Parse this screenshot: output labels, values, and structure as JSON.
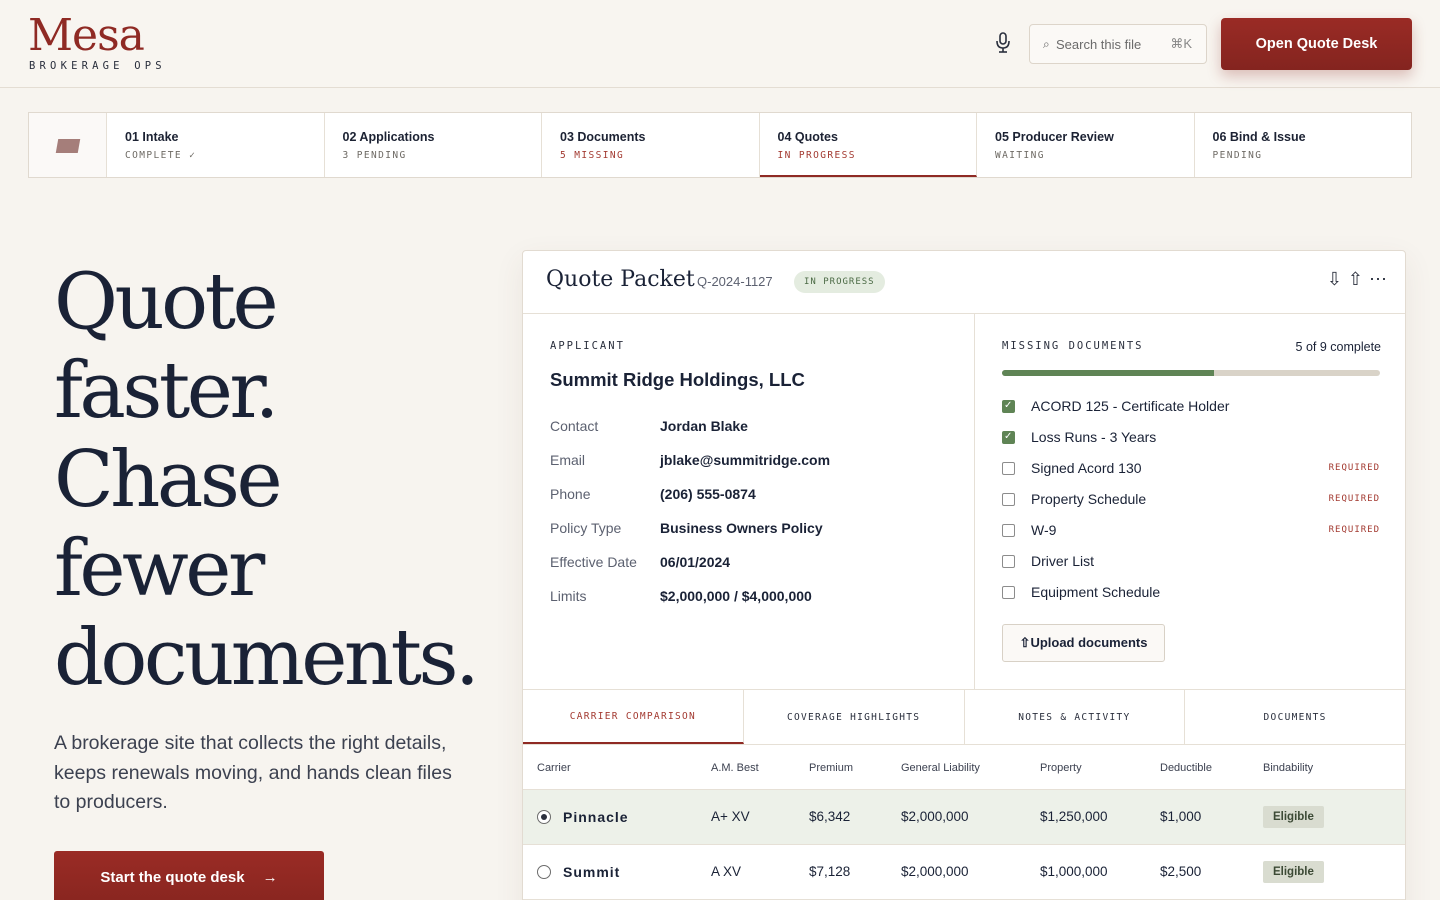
{
  "header": {
    "logo": "Mesa",
    "logo_sub": "BROKERAGE OPS",
    "search_placeholder": "Search this file",
    "search_kbd": "⌘K",
    "cta": "Open Quote Desk"
  },
  "steps": [
    {
      "title": "01 Intake",
      "status": "COMPLETE ✓"
    },
    {
      "title": "02 Applications",
      "status": "3 PENDING"
    },
    {
      "title": "03 Documents",
      "status": "5 MISSING"
    },
    {
      "title": "04 Quotes",
      "status": "IN PROGRESS"
    },
    {
      "title": "05 Producer Review",
      "status": "WAITING"
    },
    {
      "title": "06 Bind & Issue",
      "status": "PENDING"
    }
  ],
  "hero": {
    "line1": "Quote",
    "line2": "faster.",
    "line3": "Chase",
    "line4": "fewer",
    "line5": "documents.",
    "description": "A brokerage site that collects the right details, keeps renewals moving, and hands clean files to producers.",
    "cta": "Start the quote desk",
    "cta_arrow": "→"
  },
  "panel": {
    "title": "Quote Packet",
    "quote_id": "Q-2024-1127",
    "status_badge": "IN PROGRESS",
    "applicant_label": "APPLICANT",
    "applicant_name": "Summit Ridge Holdings, LLC",
    "details": [
      {
        "key": "Contact",
        "value": "Jordan Blake"
      },
      {
        "key": "Email",
        "value": "jblake@summitridge.com"
      },
      {
        "key": "Phone",
        "value": "(206) 555-0874"
      },
      {
        "key": "Policy Type",
        "value": "Business Owners Policy"
      },
      {
        "key": "Effective Date",
        "value": "06/01/2024"
      },
      {
        "key": "Limits",
        "value": "$2,000,000 / $4,000,000"
      }
    ],
    "missing_label": "MISSING DOCUMENTS",
    "complete_count": "5 of 9 complete",
    "progress": 0.56,
    "documents": [
      {
        "name": "ACORD 125 - Certificate Holder",
        "checked": true,
        "required": ""
      },
      {
        "name": "Loss Runs - 3 Years",
        "checked": true,
        "required": ""
      },
      {
        "name": "Signed Acord 130",
        "checked": false,
        "required": "REQUIRED"
      },
      {
        "name": "Property Schedule",
        "checked": false,
        "required": "REQUIRED"
      },
      {
        "name": "W-9",
        "checked": false,
        "required": "REQUIRED"
      },
      {
        "name": "Driver List",
        "checked": false,
        "required": ""
      },
      {
        "name": "Equipment Schedule",
        "checked": false,
        "required": ""
      }
    ],
    "upload_label": "⇧Upload documents",
    "tabs": [
      "CARRIER COMPARISON",
      "COVERAGE HIGHLIGHTS",
      "NOTES & ACTIVITY",
      "DOCUMENTS"
    ],
    "table_headers": [
      "Carrier",
      "A.M. Best",
      "Premium",
      "General Liability",
      "Property",
      "Deductible",
      "Bindability"
    ],
    "rows": [
      {
        "carrier": "Pinnacle",
        "am_best": "A+ XV",
        "premium": "$6,342",
        "gl": "$2,000,000",
        "property": "$1,250,000",
        "deductible": "$1,000",
        "bindability": "Eligible"
      },
      {
        "carrier": "Summit",
        "am_best": "A XV",
        "premium": "$7,128",
        "gl": "$2,000,000",
        "property": "$1,000,000",
        "deductible": "$2,500",
        "bindability": "Eligible"
      }
    ]
  },
  "colors": {
    "brand": "#8f2a24",
    "success": "#5f8455",
    "ink": "#1a2236"
  }
}
